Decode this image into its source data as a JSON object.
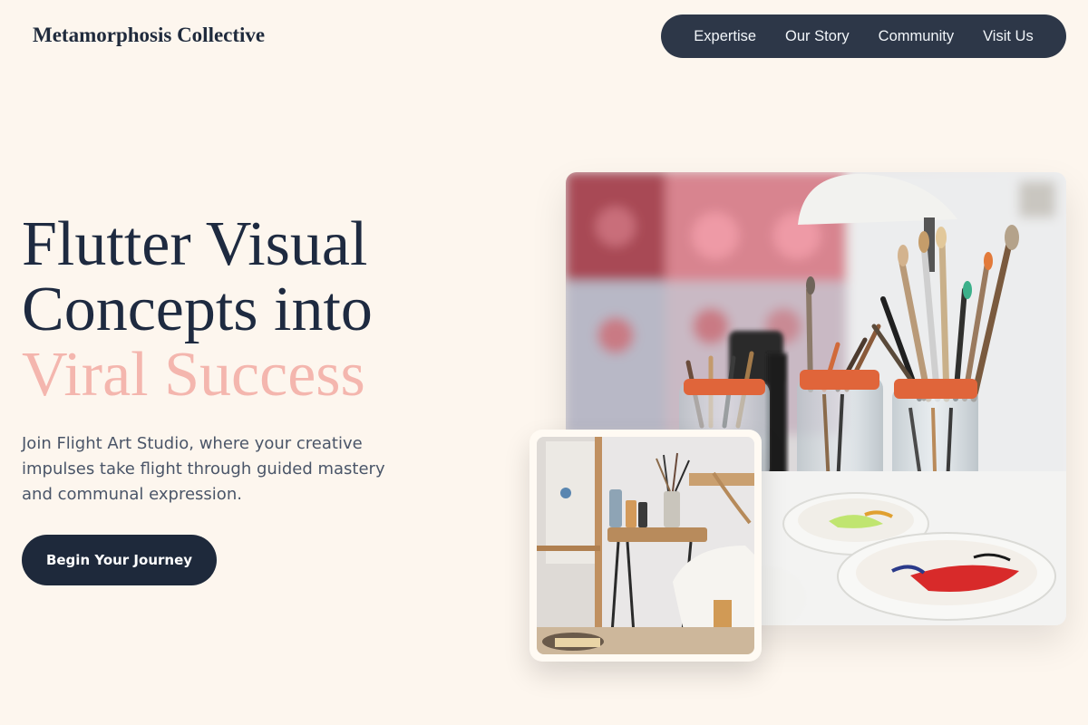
{
  "brand": {
    "name": "Metamorphosis Collective"
  },
  "nav": {
    "items": [
      {
        "label": "Expertise"
      },
      {
        "label": "Our Story"
      },
      {
        "label": "Community"
      },
      {
        "label": "Visit Us"
      }
    ]
  },
  "hero": {
    "headline_line1": "Flutter Visual",
    "headline_line2": "Concepts into",
    "headline_accent": "Viral Success",
    "subtitle": "Join Flight Art Studio, where your creative impulses take flight through guided mastery and communal expression.",
    "cta_label": "Begin Your Journey"
  },
  "colors": {
    "background": "#fdf6ee",
    "nav_bg": "#2d3748",
    "headline": "#1e2a40",
    "accent": "#f4b6ae",
    "button_bg": "#1e293b"
  }
}
